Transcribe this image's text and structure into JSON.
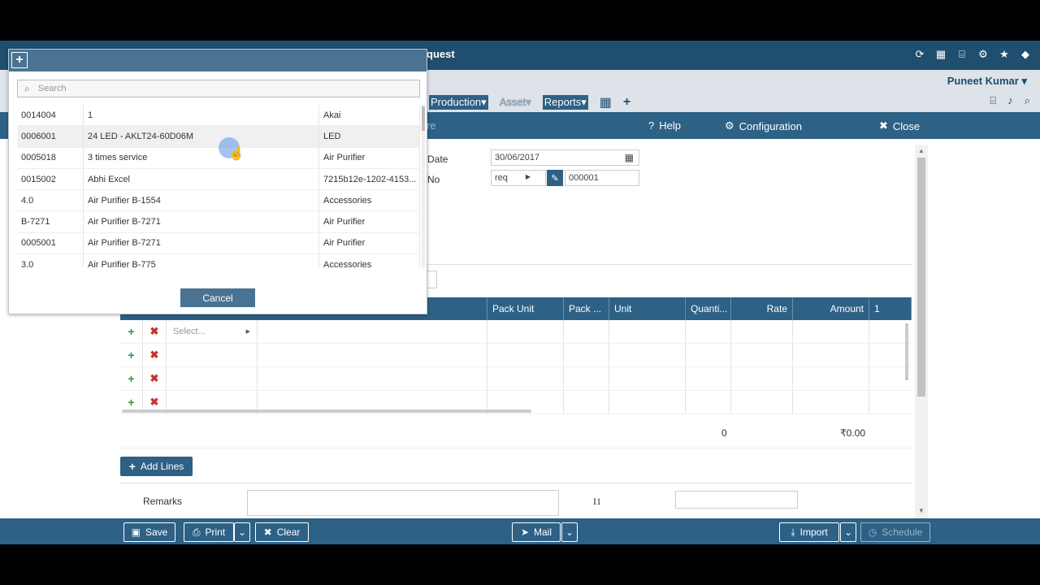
{
  "topbar": {
    "title": "quest",
    "icons": [
      "refresh-icon",
      "calendar-icon",
      "folder-open-icon",
      "gear-icon",
      "star-icon",
      "tag-icon"
    ]
  },
  "user": {
    "name": "Puneet Kumar"
  },
  "menus": [
    {
      "label": "Production",
      "state": "normal"
    },
    {
      "label": "Asset",
      "state": "dim"
    },
    {
      "label": "Reports",
      "state": "normal"
    }
  ],
  "subheader": {
    "left": "re",
    "help": "Help",
    "configuration": "Configuration",
    "close": "Close"
  },
  "form": {
    "date_label": "Date",
    "date_value": "30/06/2017",
    "no_label": "No",
    "no_prefix": "req",
    "no_value": "000001",
    "remarks_label": "Remarks",
    "i1_label": "I1"
  },
  "grid": {
    "headers": [
      "Pack Unit",
      "Pack ...",
      "Unit",
      "Quanti...",
      "Rate",
      "Amount",
      "1"
    ],
    "select_placeholder": "Select...",
    "total_qty": "0",
    "total_amount": "₹0.00",
    "add_lines": "Add Lines"
  },
  "footer": {
    "save": "Save",
    "print": "Print",
    "clear": "Clear",
    "mail": "Mail",
    "import": "Import",
    "schedule": "Schedule"
  },
  "modal": {
    "search_placeholder": "Search",
    "cancel": "Cancel",
    "rows": [
      [
        "0014004",
        "1",
        "Akai"
      ],
      [
        "0006001",
        "24 LED - AKLT24-60D06M",
        "LED"
      ],
      [
        "0005018",
        "3 times service",
        "Air Purifier"
      ],
      [
        "0015002",
        "Abhi Excel",
        "7215b12e-1202-4153..."
      ],
      [
        "4.0",
        "Air Purifier B-1554",
        "Accessories"
      ],
      [
        "B-7271",
        "Air Purifier B-7271",
        "Air Purifier"
      ],
      [
        "0005001",
        "Air Purifier B-7271",
        "Air Purifier"
      ],
      [
        "3.0",
        "Air Purifier B-775",
        "Accessories"
      ]
    ]
  }
}
